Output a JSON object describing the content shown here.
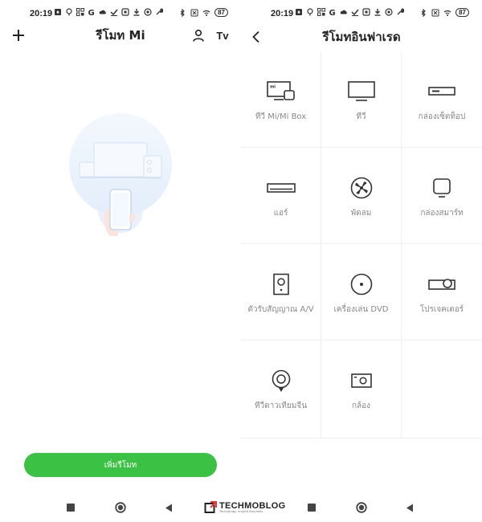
{
  "status": {
    "time": "20:19",
    "battery": "87"
  },
  "left_screen": {
    "title": "รีโมท Mi",
    "tv_label": "Tv",
    "add_button_label": "เพิ่มรีโมท"
  },
  "right_screen": {
    "title": "รีโมทอินฟาเรด",
    "devices": [
      {
        "label": "ทีวี Mi/Mi Box",
        "icon": "mi-tv-box-icon"
      },
      {
        "label": "ทีวี",
        "icon": "tv-icon"
      },
      {
        "label": "กล่องเซ็ตท็อป",
        "icon": "set-top-box-icon"
      },
      {
        "label": "แอร์",
        "icon": "air-conditioner-icon"
      },
      {
        "label": "พัดลม",
        "icon": "fan-icon"
      },
      {
        "label": "กล่องสมาร์ท",
        "icon": "smart-box-icon"
      },
      {
        "label": "ตัวรับสัญญาณ A/V",
        "icon": "av-receiver-icon"
      },
      {
        "label": "เครื่องเล่น DVD",
        "icon": "dvd-player-icon"
      },
      {
        "label": "โปรเจคเตอร์",
        "icon": "projector-icon"
      },
      {
        "label": "ทีวีดาวเทียมจีน",
        "icon": "satellite-tv-icon"
      },
      {
        "label": "กล้อง",
        "icon": "camera-icon"
      }
    ]
  },
  "watermark": {
    "main": "TECHMOBLOG",
    "sub": "Technology Inspire Business"
  },
  "colors": {
    "accent": "#3bc143",
    "divider": "#eeeeee",
    "label_gray": "#888888"
  }
}
